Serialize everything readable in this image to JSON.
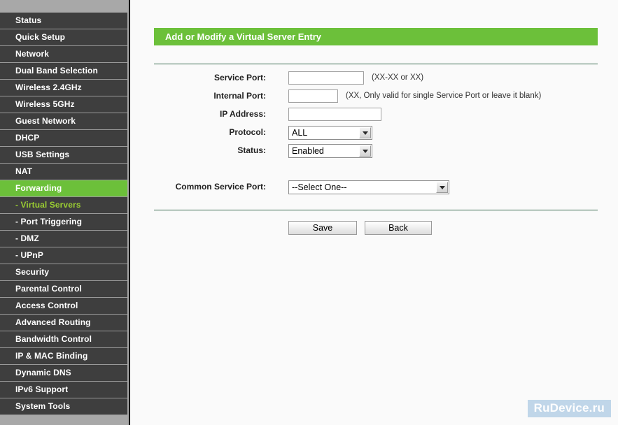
{
  "sidebar": {
    "items": [
      {
        "label": "Status",
        "type": "main",
        "state": "normal"
      },
      {
        "label": "Quick Setup",
        "type": "main",
        "state": "normal"
      },
      {
        "label": "Network",
        "type": "main",
        "state": "normal"
      },
      {
        "label": "Dual Band Selection",
        "type": "main",
        "state": "normal"
      },
      {
        "label": "Wireless 2.4GHz",
        "type": "main",
        "state": "normal"
      },
      {
        "label": "Wireless 5GHz",
        "type": "main",
        "state": "normal"
      },
      {
        "label": "Guest Network",
        "type": "main",
        "state": "normal"
      },
      {
        "label": "DHCP",
        "type": "main",
        "state": "normal"
      },
      {
        "label": "USB Settings",
        "type": "main",
        "state": "normal"
      },
      {
        "label": "NAT",
        "type": "main",
        "state": "normal"
      },
      {
        "label": "Forwarding",
        "type": "main",
        "state": "active"
      },
      {
        "label": "- Virtual Servers",
        "type": "sub",
        "state": "sub-active"
      },
      {
        "label": "- Port Triggering",
        "type": "sub",
        "state": "normal"
      },
      {
        "label": "- DMZ",
        "type": "sub",
        "state": "normal"
      },
      {
        "label": "- UPnP",
        "type": "sub",
        "state": "normal"
      },
      {
        "label": "Security",
        "type": "main",
        "state": "normal"
      },
      {
        "label": "Parental Control",
        "type": "main",
        "state": "normal"
      },
      {
        "label": "Access Control",
        "type": "main",
        "state": "normal"
      },
      {
        "label": "Advanced Routing",
        "type": "main",
        "state": "normal"
      },
      {
        "label": "Bandwidth Control",
        "type": "main",
        "state": "normal"
      },
      {
        "label": "IP & MAC Binding",
        "type": "main",
        "state": "normal"
      },
      {
        "label": "Dynamic DNS",
        "type": "main",
        "state": "normal"
      },
      {
        "label": "IPv6 Support",
        "type": "main",
        "state": "normal"
      },
      {
        "label": "System Tools",
        "type": "main",
        "state": "normal"
      }
    ]
  },
  "main": {
    "page_title": "Add or Modify a Virtual Server Entry",
    "fields": {
      "service_port": {
        "label": "Service Port:",
        "value": "",
        "placeholder": "",
        "hint": "(XX-XX or XX)"
      },
      "internal_port": {
        "label": "Internal Port:",
        "value": "",
        "placeholder": "",
        "hint": "(XX, Only valid for single Service Port or leave it blank)"
      },
      "ip_address": {
        "label": "IP Address:",
        "value": "",
        "placeholder": "",
        "hint": ""
      },
      "protocol": {
        "label": "Protocol:",
        "value": "ALL"
      },
      "status": {
        "label": "Status:",
        "value": "Enabled"
      },
      "common_service_port": {
        "label": "Common Service Port:",
        "value": "--Select One--"
      }
    },
    "buttons": {
      "save": "Save",
      "back": "Back"
    }
  },
  "watermark": {
    "text": "RuDevice.ru"
  },
  "colors": {
    "accent_green": "#6cc03a",
    "sidebar_dark": "#3e3e3e",
    "sidebar_outer": "#a8a8a8",
    "rule_green": "#3b6b51",
    "sub_active_text": "#9acd32",
    "watermark_bg": "#bcd3e8"
  }
}
